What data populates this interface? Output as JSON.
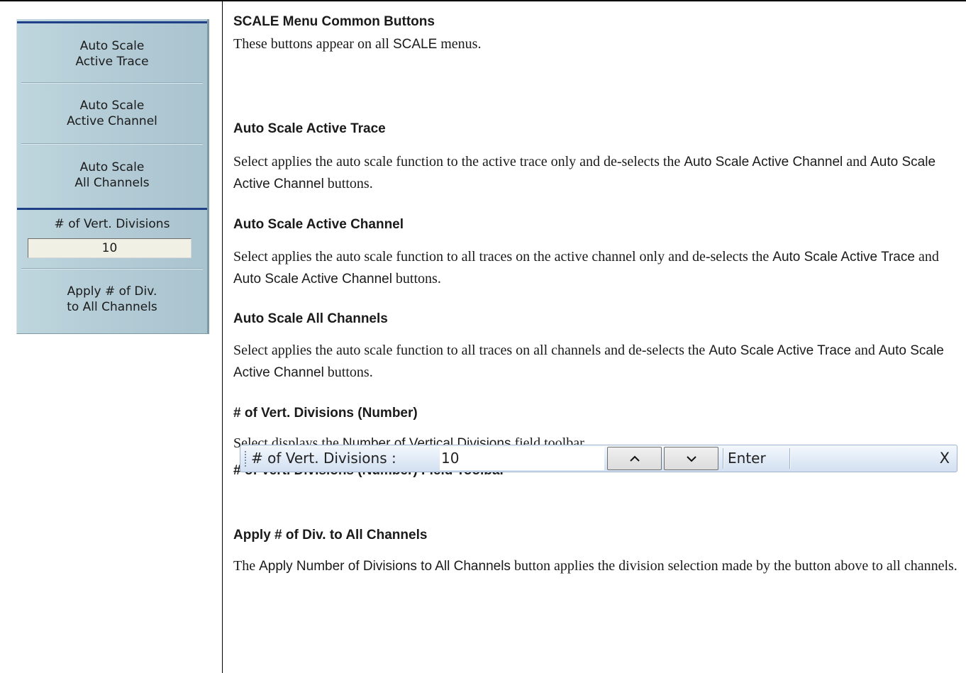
{
  "menu": {
    "buttons": [
      {
        "line1": "Auto Scale",
        "line2": "Active Trace"
      },
      {
        "line1": "Auto Scale",
        "line2": "Active Channel"
      },
      {
        "line1": "Auto Scale",
        "line2": "All Channels"
      }
    ],
    "num_divisions": {
      "label": "# of Vert. Divisions",
      "value": "10"
    },
    "apply_button": {
      "line1": "Apply # of Div.",
      "line2": "to All Channels"
    }
  },
  "doc": {
    "title": "SCALE Menu Common Buttons",
    "intro": {
      "t1": "These buttons appear on all ",
      "ui1": "SCALE",
      "t2": " menus."
    },
    "sections": {
      "auto_trace": {
        "heading": "Auto Scale Active Trace",
        "t1": "Select applies the auto scale function to the active trace only and de-selects the ",
        "ui1": "Auto Scale Active Channel",
        "t2": " and ",
        "ui2": "Auto Scale Active Channel",
        "t3": " buttons."
      },
      "auto_channel": {
        "heading": "Auto Scale Active Channel",
        "t1": "Select applies the auto scale function to all traces on the active channel only and de-selects the ",
        "ui1": "Auto Scale Active Trace",
        "t2": " and ",
        "ui2": "Auto Scale Active Channel",
        "t3": " buttons."
      },
      "auto_all": {
        "heading": "Auto Scale All Channels",
        "t1": "Select applies the auto scale function to all traces on all channels and de-selects the ",
        "ui1": "Auto Scale Active Trace",
        "t2": " and ",
        "ui2": "Auto Scale Active Channel",
        "t3": " buttons."
      },
      "vert_div": {
        "heading": "# of Vert. Divisions (Number)",
        "t1": "Select displays the ",
        "ui1": "Number of Vertical Divisions",
        "t2": " field toolbar."
      },
      "toolbar_heading": "# of Vert. Divisions (Number) Field Toolbar",
      "apply": {
        "heading": "Apply # of Div. to All Channels",
        "t1": "The ",
        "ui1": "Apply Number of Divisions to All Channels",
        "t2": " button applies the division selection made by the button above to all channels."
      }
    }
  },
  "toolbar": {
    "label": "# of Vert. Divisions :",
    "value": "10",
    "up": "^",
    "down": "v",
    "enter": "Enter",
    "close": "X"
  }
}
